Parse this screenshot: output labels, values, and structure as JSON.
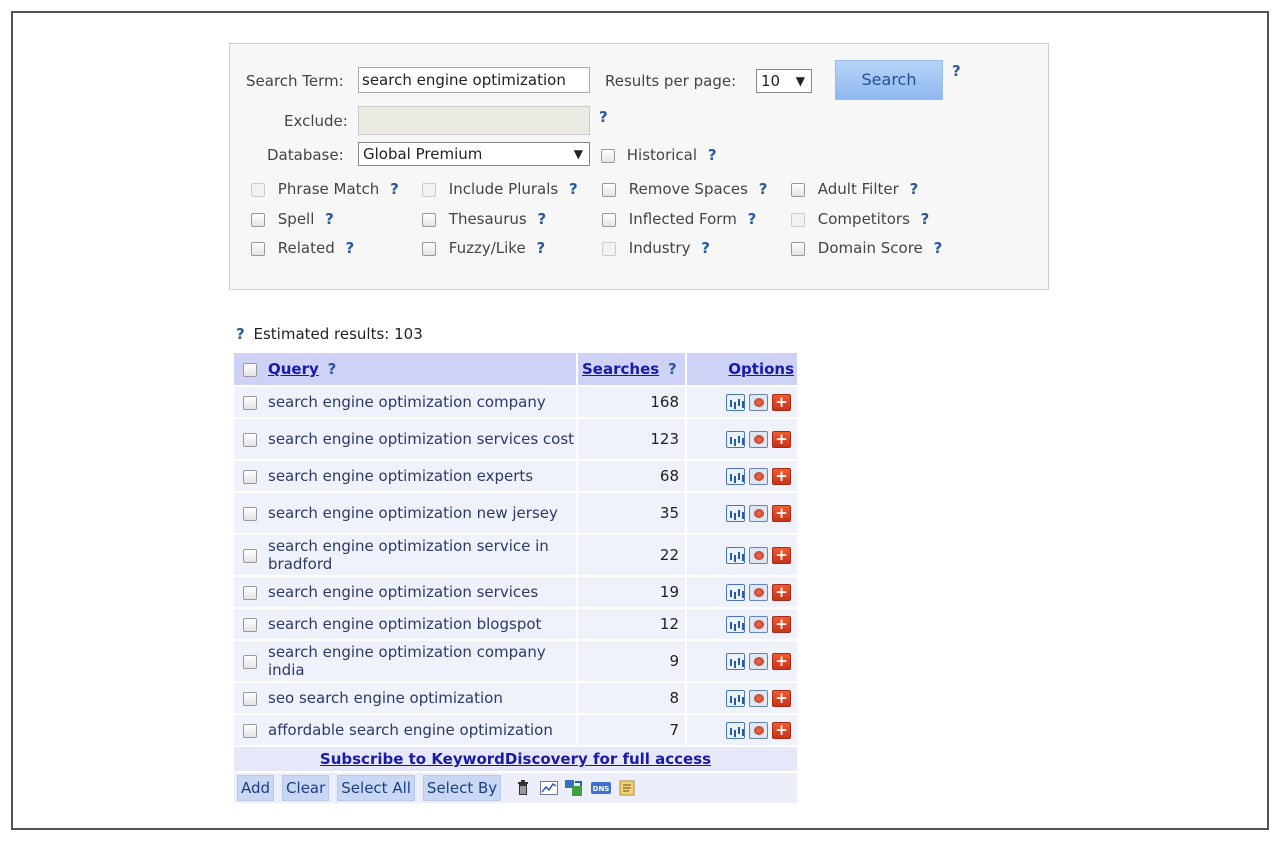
{
  "form": {
    "search_term_label": "Search Term:",
    "search_term_value": "search engine optimization",
    "results_per_page_label": "Results per page:",
    "results_per_page_value": "10",
    "search_button": "Search",
    "exclude_label": "Exclude:",
    "exclude_value": "",
    "database_label": "Database:",
    "database_value": "Global Premium",
    "historical_label": "Historical",
    "help": "?"
  },
  "options": [
    {
      "label": "Phrase Match",
      "disabled": true
    },
    {
      "label": "Include Plurals",
      "disabled": true
    },
    {
      "label": "Remove Spaces",
      "disabled": false
    },
    {
      "label": "Adult Filter",
      "disabled": false
    },
    {
      "label": "Spell",
      "disabled": false
    },
    {
      "label": "Thesaurus",
      "disabled": false
    },
    {
      "label": "Inflected Form",
      "disabled": false
    },
    {
      "label": "Competitors",
      "disabled": true
    },
    {
      "label": "Related",
      "disabled": false
    },
    {
      "label": "Fuzzy/Like",
      "disabled": false
    },
    {
      "label": "Industry",
      "disabled": true
    },
    {
      "label": "Domain Score",
      "disabled": false
    }
  ],
  "results": {
    "estimated_label": "Estimated results: 103",
    "header": {
      "query": "Query",
      "searches": "Searches",
      "options": "Options"
    },
    "rows": [
      {
        "query": "search engine optimization company",
        "searches": "168"
      },
      {
        "query": "search engine optimization services cost",
        "searches": "123"
      },
      {
        "query": "search engine optimization experts",
        "searches": "68"
      },
      {
        "query": "search engine optimization new jersey",
        "searches": "35"
      },
      {
        "query": "search engine optimization service in bradford",
        "searches": "22"
      },
      {
        "query": "search engine optimization services",
        "searches": "19"
      },
      {
        "query": "search engine optimization blogspot",
        "searches": "12"
      },
      {
        "query": "search engine optimization company india",
        "searches": "9"
      },
      {
        "query": "seo search engine optimization",
        "searches": "8"
      },
      {
        "query": "affordable search engine optimization",
        "searches": "7"
      }
    ],
    "subscribe_link": "Subscribe to KeywordDiscovery for full access",
    "buttons": {
      "add": "Add",
      "clear": "Clear",
      "select_all": "Select All",
      "select_by": "Select By"
    },
    "tool_icons": [
      "trash-icon",
      "trend-chart-icon",
      "export-icon",
      "dns-icon",
      "notes-icon"
    ]
  }
}
